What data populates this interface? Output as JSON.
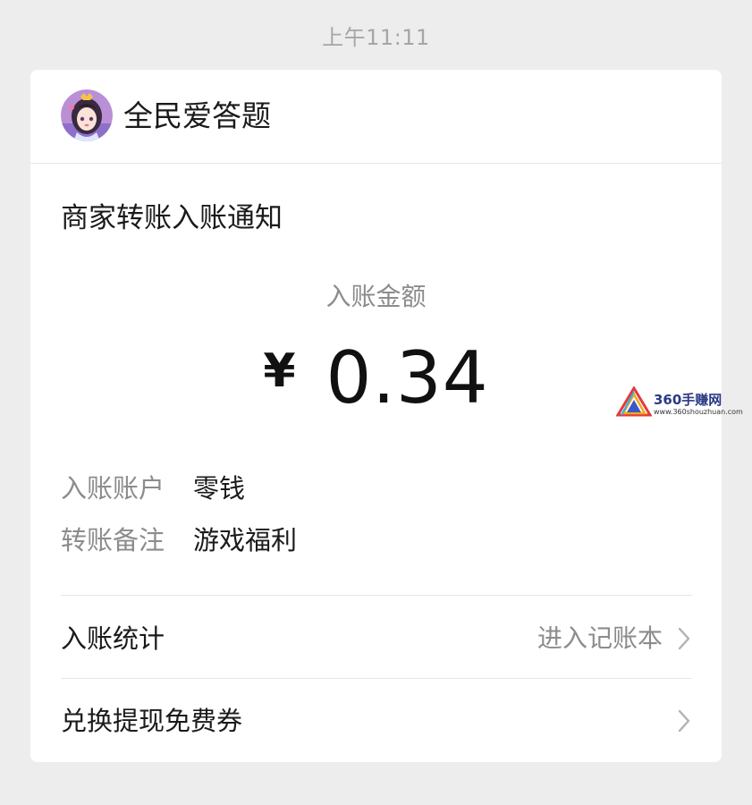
{
  "timestamp": "上午11:11",
  "header": {
    "app_name": "全民爱答题",
    "avatar_icon": "app-avatar-icon"
  },
  "notice": {
    "title": "商家转账入账通知",
    "amount_label": "入账金额",
    "currency": "¥",
    "amount": "0.34"
  },
  "details": [
    {
      "label": "入账账户",
      "value": "零钱"
    },
    {
      "label": "转账备注",
      "value": "游戏福利"
    }
  ],
  "actions": [
    {
      "label": "入账统计",
      "hint": "进入记账本",
      "icon": "chevron-right-icon"
    },
    {
      "label": "兑换提现免费券",
      "hint": "",
      "icon": "chevron-right-icon"
    }
  ],
  "watermark": {
    "name": "360手赚网",
    "url": "www.360shouzhuan.com"
  },
  "colors": {
    "background": "#ededed",
    "card": "#ffffff",
    "primary_text": "#1a1a1a",
    "secondary_text": "#8c8c8c",
    "divider": "#e6e6e6"
  }
}
